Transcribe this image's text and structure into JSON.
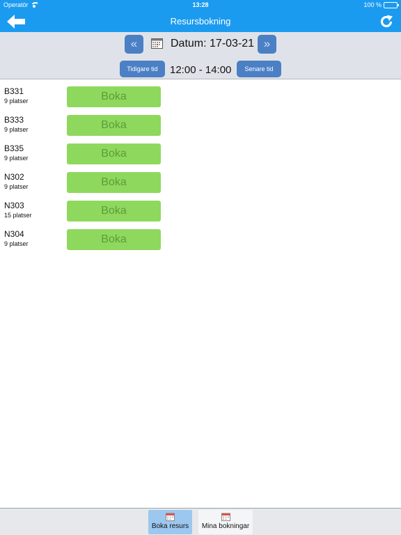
{
  "status_bar": {
    "carrier": "Operatör",
    "time": "13:28",
    "battery": "100 %"
  },
  "header": {
    "title": "Resursbokning",
    "back_icon": "arrow-left-icon",
    "refresh_icon": "refresh-icon"
  },
  "date_controls": {
    "prev_icon": "double-chevron-left-icon",
    "next_icon": "double-chevron-right-icon",
    "calendar_icon": "calendar-icon",
    "date_label": "Datum: 17-03-21",
    "earlier_label": "Tidigare tid",
    "later_label": "Senare tid",
    "time_range": "12:00 - 14:00"
  },
  "resources": [
    {
      "name": "B331",
      "seats": "9 platser",
      "button": "Boka"
    },
    {
      "name": "B333",
      "seats": "9 platser",
      "button": "Boka"
    },
    {
      "name": "B335",
      "seats": "9 platser",
      "button": "Boka"
    },
    {
      "name": "N302",
      "seats": "9 platser",
      "button": "Boka"
    },
    {
      "name": "N303",
      "seats": "15 platser",
      "button": "Boka"
    },
    {
      "name": "N304",
      "seats": "9 platser",
      "button": "Boka"
    }
  ],
  "tabs": [
    {
      "label": "Boka resurs",
      "icon": "calendar-icon",
      "active": true
    },
    {
      "label": "Mina bokningar",
      "icon": "calendar-icon",
      "active": false
    }
  ],
  "colors": {
    "accent": "#1b9bf0",
    "button_blue": "#4b80c5",
    "book_green": "#8ed95d",
    "book_text": "#5e9a3b",
    "active_tab": "#9cc8f0"
  }
}
